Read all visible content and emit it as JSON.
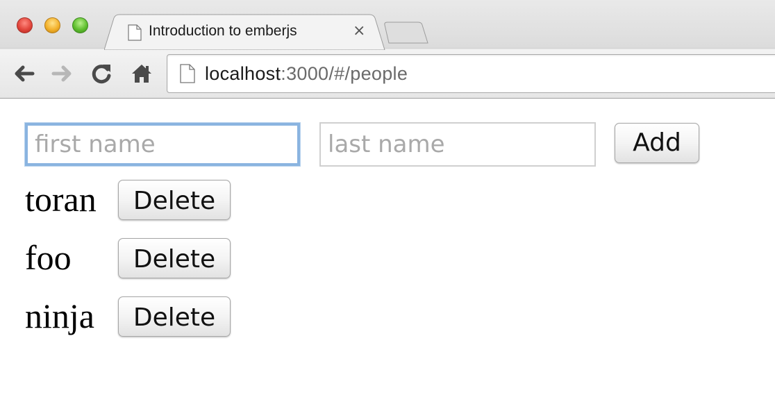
{
  "browser": {
    "tab_title": "Introduction to emberjs",
    "tab_close": "×",
    "url_host": "localhost",
    "url_path": ":3000/#/people"
  },
  "form": {
    "first_name_placeholder": "first name",
    "last_name_placeholder": "last name",
    "add_label": "Add"
  },
  "people": [
    {
      "name": "toran",
      "delete_label": "Delete"
    },
    {
      "name": "foo",
      "delete_label": "Delete"
    },
    {
      "name": "ninja",
      "delete_label": "Delete"
    }
  ]
}
